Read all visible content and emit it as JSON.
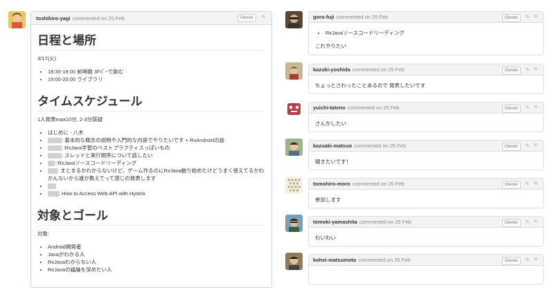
{
  "main_comment": {
    "author": "toshihiro-yagi",
    "meta": "commented on 25 Feb",
    "owner": "Owner",
    "sections": {
      "schedule": {
        "heading": "日程と場所",
        "date": "3/17(火)",
        "items": [
          "18:30-19:00 前哨戦 3Fﾊﾞｰで飲む",
          "19:00-20:00 ライブラリ"
        ]
      },
      "timetable": {
        "heading": "タイムスケジュール",
        "intro": "1人発表max10分, 2-3分質疑",
        "items": [
          "はじめに - 八木",
          ": 基本的な概念の説明や入門的な内容でやりたいです + RxAndroidの話",
          ": RxJava学習のベストプラクティスっぽいもの",
          ": スレッドと実行順序について話したい",
          ": RxJavaソースコードリーディング",
          ": まとまるかわからないけど、ゲーム作るのにRxJava触り始めたけどうまく使えてるかわかんないから誰か教えてって感じの発表します",
          "",
          ": How to Access Web API with Hystrix"
        ]
      },
      "target": {
        "heading": "対象とゴール",
        "intro": "対象:",
        "items": [
          "Android開発者",
          "Javaがわかる人",
          "RxJavaわからない人",
          "RxJavaの議論を深めたい人"
        ]
      }
    }
  },
  "right_comments": [
    {
      "author": "goro-fuji",
      "meta": "commented on 25 Feb",
      "owner": "Owner",
      "list_item": "RxJavaソースコードリーディング",
      "text": "これやりたい"
    },
    {
      "author": "kazuki-yoshida",
      "meta": "commented on 25 Feb",
      "owner": "Owner",
      "text": "ちょっとさわったことあるので 発表したいです"
    },
    {
      "author": "yuichi-tateno",
      "meta": "commented on 25 Feb",
      "owner": "Owner",
      "text": "さんかしたい"
    },
    {
      "author": "kazuaki-matsuo",
      "meta": "commented on 25 Feb",
      "owner": "Owner",
      "text": "聞きたいです！"
    },
    {
      "author": "tomohiro-moro",
      "meta": "commented on 25 Feb",
      "owner": "Owner",
      "text": "参加します"
    },
    {
      "author": "tomoki-yamashita",
      "meta": "commented on 25 Feb",
      "owner": "Owner",
      "text": "わいわい"
    },
    {
      "author": "kohei-matsumoto",
      "meta": "commented on 25 Feb",
      "owner": "Owner",
      "text": ""
    }
  ],
  "icons": {
    "edit": "pencil-icon",
    "delete": "close-icon"
  },
  "colors": {
    "header_bg": "#f3f3f3",
    "main_border": "#c8d8e8",
    "border": "#dedede"
  }
}
